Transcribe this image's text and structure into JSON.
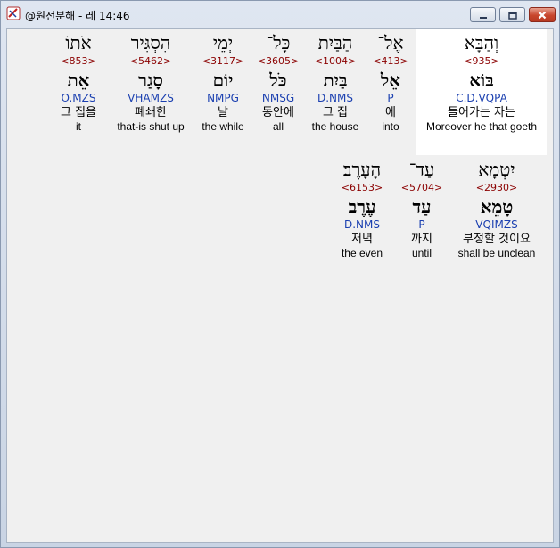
{
  "window": {
    "title": "@원전분해 - 레 14:46"
  },
  "icons": {
    "app": "app-logo-icon",
    "minimize": "minimize-icon",
    "maximize": "maximize-icon",
    "close": "close-icon"
  },
  "colors": {
    "strong": "#8b0000",
    "morph": "#1a3fb0",
    "selected_background": "#ffffff"
  },
  "line1": [
    {
      "heb": "וְהַבָּא",
      "strong": "<935>",
      "lemma": "בּוֹא",
      "morph": "C.D.VQPA",
      "kor": "들어가는 자는",
      "eng": "Moreover he that goeth",
      "selected": true
    },
    {
      "heb": "אֶל־",
      "strong": "<413>",
      "lemma": "אֵל",
      "morph": "P",
      "kor": "에",
      "eng": "into"
    },
    {
      "heb": "הַבַּיִת",
      "strong": "<1004>",
      "lemma": "בַּיִת",
      "morph": "D.NMS",
      "kor": "그 집",
      "eng": "the house"
    },
    {
      "heb": "כָּל־",
      "strong": "<3605>",
      "lemma": "כֹּל",
      "morph": "NMSG",
      "kor": "동안에",
      "eng": "all"
    },
    {
      "heb": "יְמֵי",
      "strong": "<3117>",
      "lemma": "יוֹם",
      "morph": "NMPG",
      "kor": "날",
      "eng": "the while"
    },
    {
      "heb": "הִסְגִּיר",
      "strong": "<5462>",
      "lemma": "סָגַר",
      "morph": "VHAMZS",
      "kor": "폐쇄한",
      "eng": "that-is shut up"
    },
    {
      "heb": "אֹתוֹ",
      "strong": "<853>",
      "lemma": "אֵת",
      "morph": "O.MZS",
      "kor": "그 집을",
      "eng": "it"
    }
  ],
  "line2": [
    {
      "heb": "יִטְמָא",
      "strong": "<2930>",
      "lemma": "טָמֵא",
      "morph": "VQIMZS",
      "kor": "부정할 것이요",
      "eng": "shall be unclean"
    },
    {
      "heb": "עַד־",
      "strong": "<5704>",
      "lemma": "עַד",
      "morph": "P",
      "kor": "까지",
      "eng": "until"
    },
    {
      "heb": "הָעָרֶב׃",
      "strong": "<6153>",
      "lemma": "עֶרֶב",
      "morph": "D.NMS",
      "kor": "저녁",
      "eng": "the even"
    }
  ]
}
